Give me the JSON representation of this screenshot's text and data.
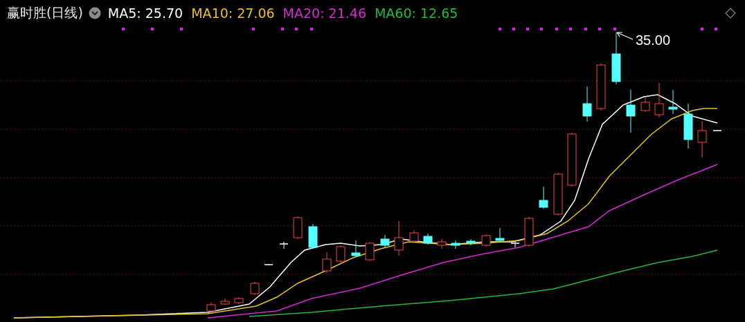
{
  "title": "赢时胜(日线)",
  "indicators": [
    {
      "label": "MA5: 25.70",
      "color": "#ffffff"
    },
    {
      "label": "MA10: 27.06",
      "color": "#e8c21c"
    },
    {
      "label": "MA20: 21.46",
      "color": "#d42ad4"
    },
    {
      "label": "MA60: 12.65",
      "color": "#22b83a"
    }
  ],
  "chart": {
    "high_label": "35.00"
  }
}
